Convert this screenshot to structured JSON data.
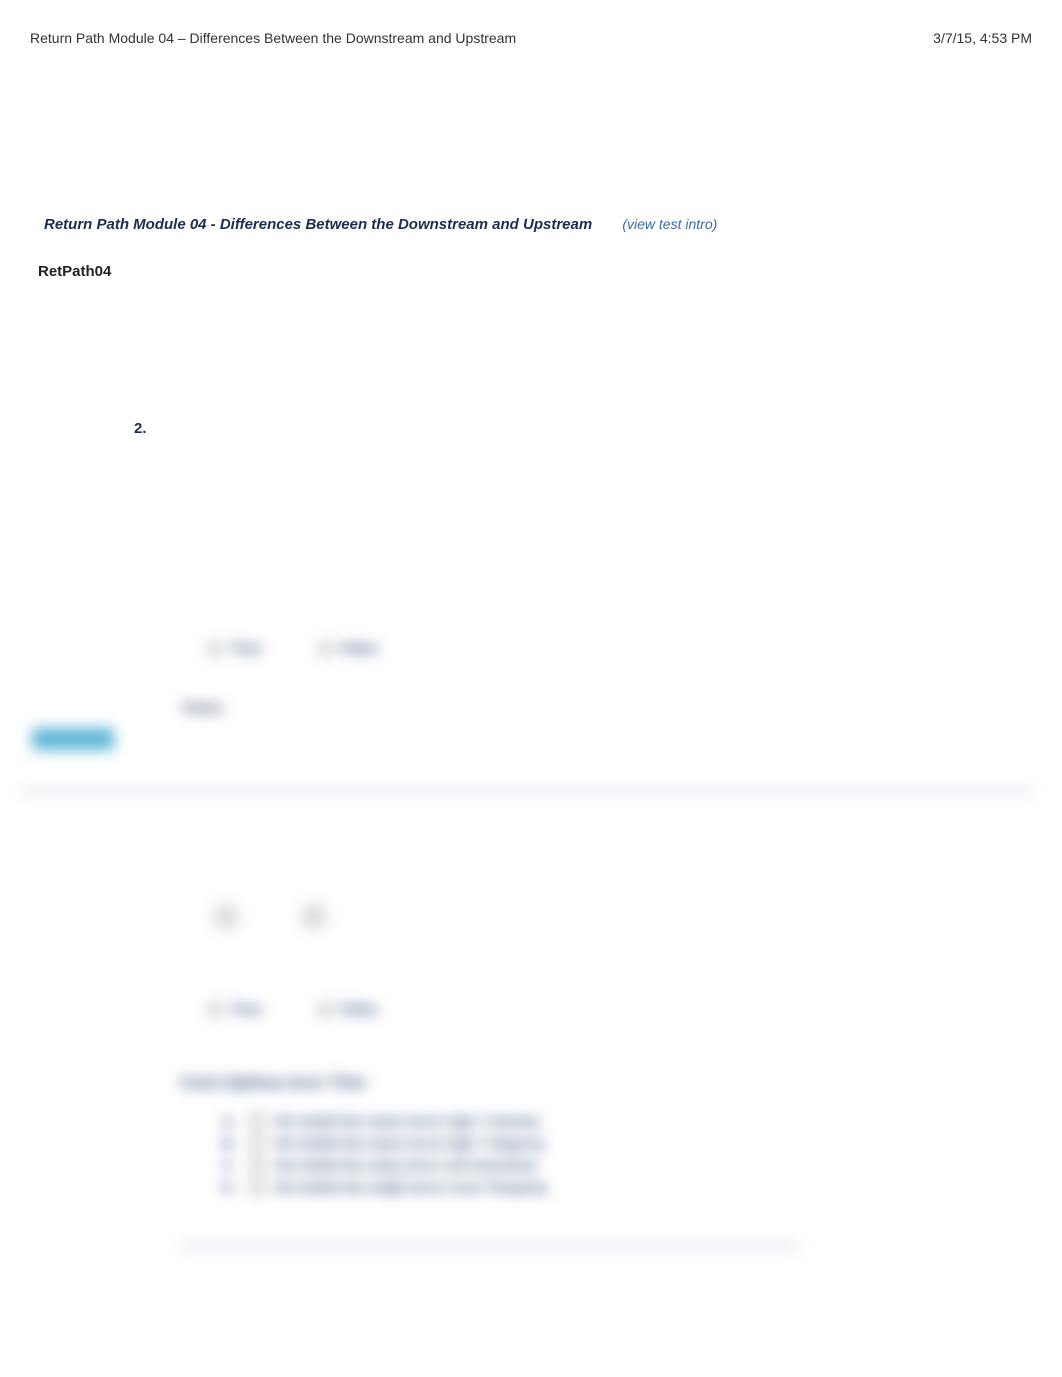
{
  "header": {
    "title": "Return Path Module 04 – Differences Between the Downstream and Upstream",
    "timestamp": "3/7/15, 4:53 PM"
  },
  "doc": {
    "title": "Return Path Module 04 - Differences Between the Downstream and Upstream",
    "view_intro": "(view test intro)",
    "short_title": "RetPath04"
  },
  "question": {
    "number": "2."
  },
  "blurred": {
    "true_label": "True",
    "false_label": "False",
    "false_answer": "False",
    "circle_a": "A",
    "circle_b": "B",
    "true_label2": "True",
    "false_label2": "False",
    "q_title": "Cont Optima inror Ther",
    "choices": [
      {
        "letter": "A.",
        "text": "All retatid the mane terror ligh 7 minstry"
      },
      {
        "letter": "B.",
        "text": "All retatid the mane terror ligh 7 thigurny"
      },
      {
        "letter": "C.",
        "text": "All retatid the maty terror toil honestnal"
      },
      {
        "letter": "D.",
        "text": "All retatid tint satgh terror trom Thequiny"
      }
    ]
  }
}
